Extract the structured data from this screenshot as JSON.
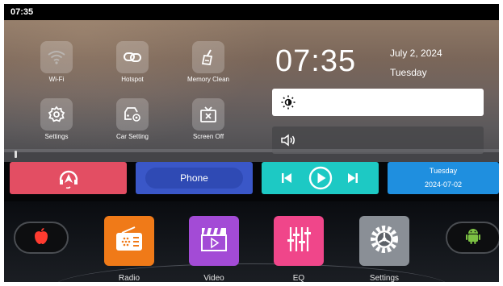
{
  "status_bar": {
    "time": "07:35"
  },
  "quick_settings": [
    {
      "label": "Wi-Fi",
      "icon": "wifi-icon"
    },
    {
      "label": "Hotspot",
      "icon": "hotspot-icon"
    },
    {
      "label": "Memory Clean",
      "icon": "broom-icon"
    },
    {
      "label": "Settings",
      "icon": "gear-icon"
    },
    {
      "label": "Car Setting",
      "icon": "car-settings-icon"
    },
    {
      "label": "Screen Off",
      "icon": "screen-off-icon"
    }
  ],
  "clock": {
    "time": "07:35",
    "date": "July 2, 2024",
    "weekday": "Tuesday"
  },
  "sliders": {
    "brightness_icon": "sun-icon",
    "volume_icon": "speaker-icon"
  },
  "cards": {
    "navigation_icon": "navigation-icon",
    "phone_label": "Phone",
    "media_icons": [
      "previous-icon",
      "play-icon",
      "next-icon"
    ],
    "date_card": {
      "weekday": "Tuesday",
      "date": "2024-07-02"
    }
  },
  "dock": {
    "left": {
      "icon": "apple-icon"
    },
    "right": {
      "icon": "android-icon"
    },
    "apps": [
      {
        "label": "Radio",
        "icon": "radio-icon",
        "color": "#f07a18"
      },
      {
        "label": "Video",
        "icon": "clapperboard-icon",
        "color": "#a34bd6"
      },
      {
        "label": "EQ",
        "icon": "equalizer-icon",
        "color": "#f0468a"
      },
      {
        "label": "Settings",
        "icon": "settings-gear-icon",
        "color": "#8a8f96"
      }
    ]
  },
  "colors": {
    "red_card": "#e34e63",
    "blue_card": "#3a57c8",
    "teal_card": "#1dc9c4",
    "sky_card": "#1f8fdf"
  }
}
